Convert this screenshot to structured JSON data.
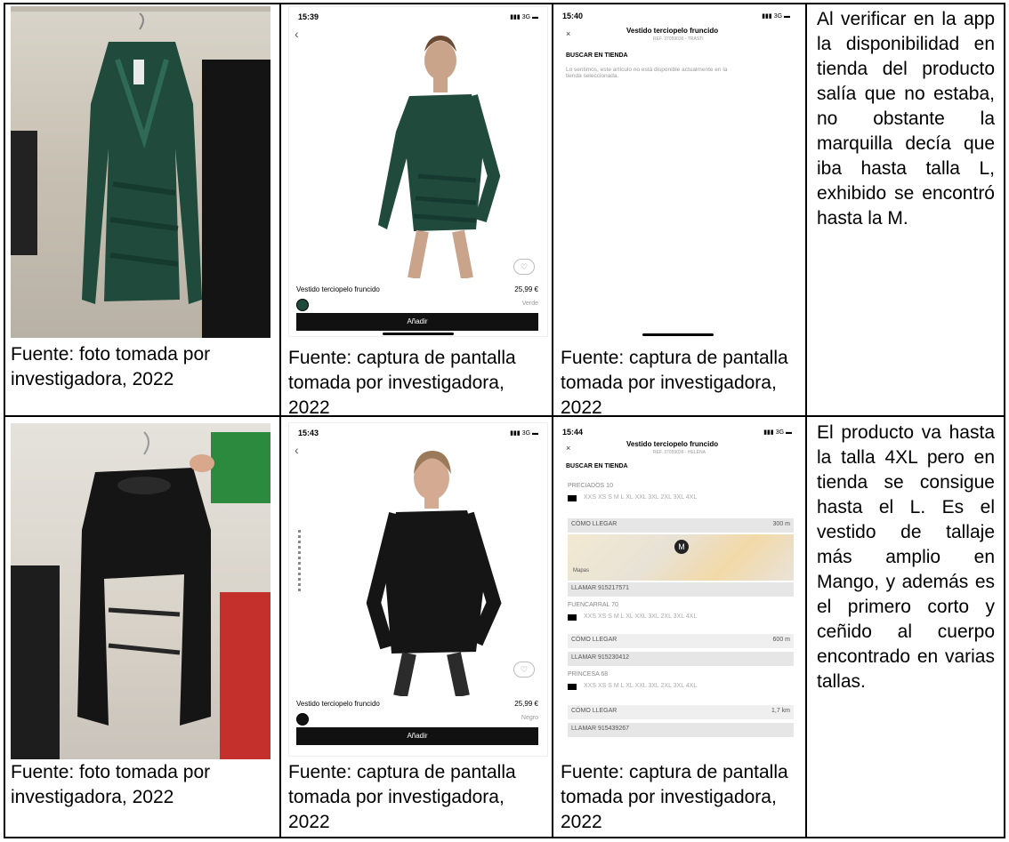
{
  "rows": [
    {
      "photo_caption": "Fuente: foto tomada por investigadora, 2022",
      "app_caption": "Fuente: captura de pantalla tomada por investigadora, 2022",
      "store_caption": "Fuente: captura de pantalla tomada por investigadora, 2022",
      "description": "Al verificar en la app la disponibilidad en tienda del producto salía que no estaba, no obstante la marquilla decía que iba hasta talla L, exhibido se encontró hasta la M.",
      "app": {
        "time": "15:39",
        "product": "Vestido terciopelo fruncido",
        "price": "25,99 €",
        "color": "Verde",
        "add": "Añadir"
      },
      "store": {
        "time": "15:40",
        "title": "Vestido terciopelo fruncido",
        "ref": "REF. 37059036 - TRASTI",
        "section": "BUSCAR EN TIENDA",
        "message": "Lo sentimos, este artículo no está disponible actualmente en la tienda seleccionada."
      }
    },
    {
      "photo_caption": "Fuente: foto tomada por investigadora, 2022",
      "app_caption": "Fuente: captura de pantalla tomada por investigadora, 2022",
      "store_caption": "Fuente: captura de pantalla tomada por investigadora, 2022",
      "description": "El producto va hasta la talla 4XL pero en tienda se consigue hasta el L. Es el vestido de tallaje más amplio en Mango, y además es el primero corto y ceñido al cuerpo encontrado en varias tallas.",
      "app": {
        "time": "15:43",
        "product": "Vestido terciopelo fruncido",
        "price": "25,99 €",
        "color": "Negro",
        "add": "Añadir"
      },
      "store": {
        "time": "15:44",
        "title": "Vestido terciopelo fruncido",
        "ref": "REF. 37059036 - HELENA",
        "section": "BUSCAR EN TIENDA",
        "stores": [
          {
            "name": "PRECIADOS 10",
            "sizes": "XXS  XS  S  M  L  XL  XXL  3XL  2XL  3XL  4XL",
            "route": "CÓMO LLEGAR",
            "distance": "300 m",
            "call": "LLAMAR 915217571"
          },
          {
            "name": "FUENCARRAL 70",
            "sizes": "XXS  XS  S  M  L  XL  XXL  3XL  2XL  3XL  4XL",
            "route": "CÓMO LLEGAR",
            "distance": "600 m",
            "call": "LLAMAR 915230412"
          },
          {
            "name": "PRINCESA 68",
            "sizes": "XXS  XS  S  M  L  XL  XXL  3XL  2XL  3XL  4XL",
            "route": "CÓMO LLEGAR",
            "distance": "1,7 km",
            "call": "LLAMAR 915439267"
          }
        ],
        "map_label": "Mapas"
      }
    }
  ],
  "colors": {
    "green_dress": "#1f4a3c",
    "black_dress": "#151515",
    "border": "#000000"
  }
}
